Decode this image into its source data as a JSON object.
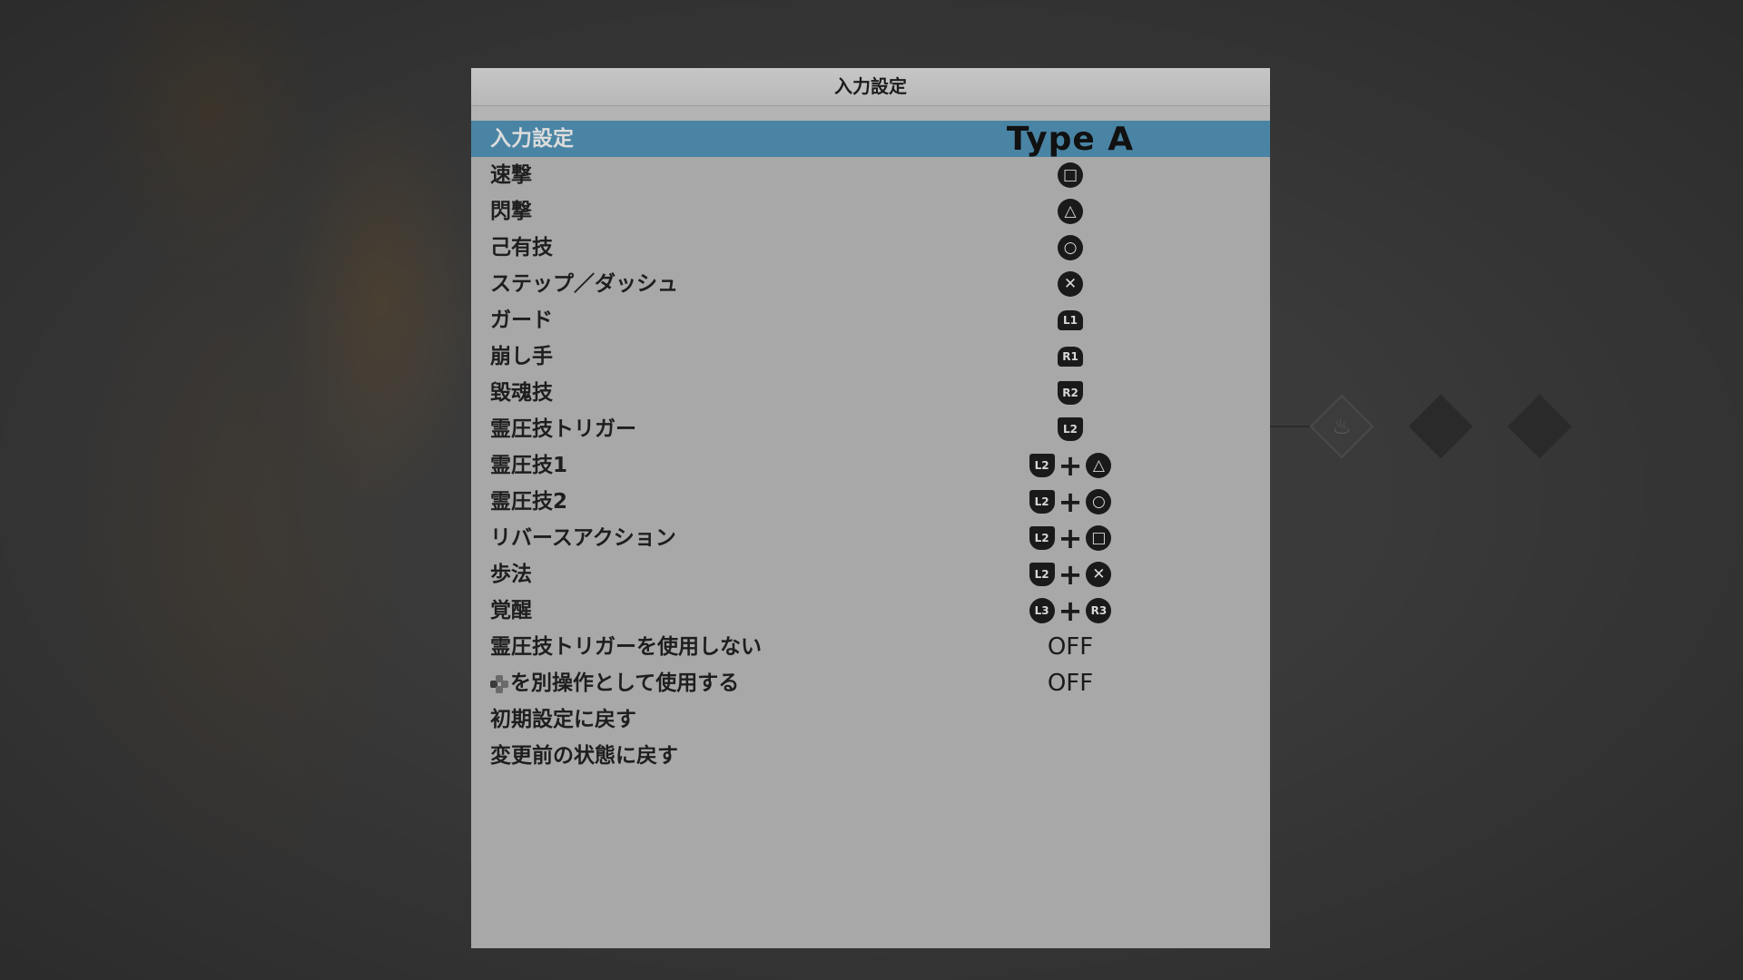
{
  "header": {
    "title": "入力設定"
  },
  "rows": [
    {
      "label": "入力設定",
      "value": "Type A"
    },
    {
      "label": "速撃",
      "button": "square"
    },
    {
      "label": "閃撃",
      "button": "triangle"
    },
    {
      "label": "己有技",
      "button": "circle"
    },
    {
      "label": "ステップ／ダッシュ",
      "button": "cross"
    },
    {
      "label": "ガード",
      "button": "L1"
    },
    {
      "label": "崩し手",
      "button": "R1"
    },
    {
      "label": "毀魂技",
      "button": "R2"
    },
    {
      "label": "霊圧技トリガー",
      "button": "L2"
    },
    {
      "label": "霊圧技1",
      "combo": [
        "L2",
        "triangle"
      ]
    },
    {
      "label": "霊圧技2",
      "combo": [
        "L2",
        "circle"
      ]
    },
    {
      "label": "リバースアクション",
      "combo": [
        "L2",
        "square"
      ]
    },
    {
      "label": "歩法",
      "combo": [
        "L2",
        "cross"
      ]
    },
    {
      "label": "覚醒",
      "combo": [
        "L3",
        "R3"
      ]
    },
    {
      "label": "霊圧技トリガーを使用しない",
      "value": "OFF"
    },
    {
      "label": "を別操作として使用する",
      "value": "OFF",
      "icon": "dpad-left-icon"
    },
    {
      "label": "初期設定に戻す"
    },
    {
      "label": "変更前の状態に戻す"
    }
  ],
  "glyphs": {
    "square": "□",
    "triangle": "△",
    "circle": "○",
    "cross": "✕",
    "L1": "L1",
    "R1": "R1",
    "R2": "R2",
    "L2": "L2",
    "L3": "L3",
    "R3": "R3",
    "plus": "+"
  },
  "selected_row": 0,
  "colors": {
    "selected": "#4a84a4",
    "panel": "#a8a8a8",
    "background": "#3a3a3a"
  }
}
